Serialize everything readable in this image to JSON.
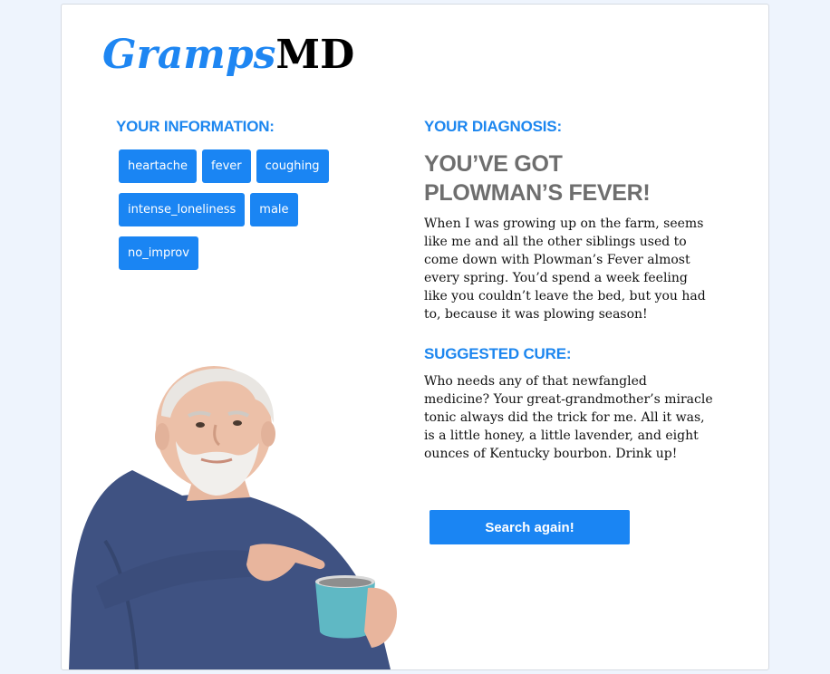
{
  "logo": {
    "part1": "Gramps",
    "part2": "MD"
  },
  "info": {
    "heading": "YOUR INFORMATION:",
    "tags": [
      "heartache",
      "fever",
      "coughing",
      "intense_loneliness",
      "male",
      "no_improv"
    ]
  },
  "diagnosis": {
    "heading": "YOUR DIAGNOSIS:",
    "title": "YOU’VE GOT PLOWMAN’S FEVER!",
    "description": "When I was growing up on the farm, seems like me and all the other siblings used to come down with Plowman’s Fever almost every spring. You’d spend a week feeling like you couldn’t leave the bed, but you had to, because it was plowing season!"
  },
  "cure": {
    "heading": "SUGGESTED CURE:",
    "description": "Who needs any of that newfangled medicine? Your great-grandmother’s miracle tonic always did the trick for me. All it was, is a little honey, a little lavender, and eight ounces of Kentucky bourbon. Drink up!"
  },
  "search_button": "Search again!",
  "colors": {
    "accent": "#1a85f3",
    "page_bg": "#eef4fd",
    "title_gray": "#6e6e6e"
  }
}
